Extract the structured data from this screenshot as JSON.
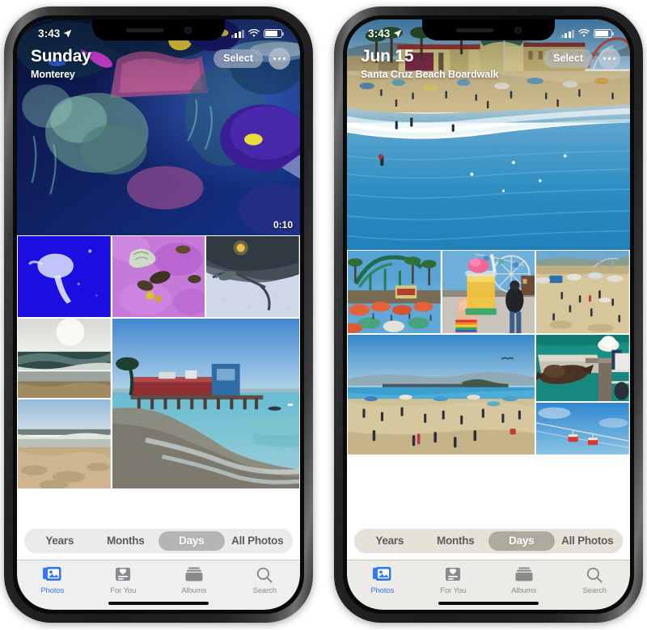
{
  "phones": [
    {
      "id": "phone-left",
      "status_bar": {
        "time": "3:43",
        "location_icon": "location-arrow-icon",
        "signal_icon": "cellular-signal-icon",
        "wifi_icon": "wifi-icon",
        "battery_icon": "battery-icon"
      },
      "header": {
        "title": "Sunday",
        "subtitle": "Monterey",
        "select_label": "Select",
        "more_icon": "ellipsis-icon"
      },
      "hero": {
        "scene": "aquarium-coral-reef",
        "duration": "0:10",
        "is_video": true
      },
      "segmented_control": {
        "items": [
          "Years",
          "Months",
          "Days",
          "All Photos"
        ],
        "selected": "Days",
        "tint": "cool"
      },
      "tab_bar": {
        "tint": "cool",
        "items": [
          {
            "label": "Photos",
            "icon": "photos-icon",
            "active": true
          },
          {
            "label": "For You",
            "icon": "foryou-icon",
            "active": false
          },
          {
            "label": "Albums",
            "icon": "albums-icon",
            "active": false
          },
          {
            "label": "Search",
            "icon": "search-icon",
            "active": false
          }
        ]
      }
    },
    {
      "id": "phone-right",
      "status_bar": {
        "time": "3:43",
        "location_icon": "location-arrow-icon",
        "signal_icon": "cellular-signal-icon",
        "wifi_icon": "wifi-icon",
        "battery_icon": "battery-icon"
      },
      "header": {
        "title": "Jun 15",
        "subtitle": "Santa Cruz Beach Boardwalk",
        "select_label": "Select",
        "more_icon": "ellipsis-icon"
      },
      "hero": {
        "scene": "santa-cruz-beach-aerial",
        "duration": "",
        "is_video": false
      },
      "segmented_control": {
        "items": [
          "Years",
          "Months",
          "Days",
          "All Photos"
        ],
        "selected": "Days",
        "tint": "warm"
      },
      "tab_bar": {
        "tint": "warm",
        "items": [
          {
            "label": "Photos",
            "icon": "photos-icon",
            "active": true
          },
          {
            "label": "For You",
            "icon": "foryou-icon",
            "active": false
          },
          {
            "label": "Albums",
            "icon": "albums-icon",
            "active": false
          },
          {
            "label": "Search",
            "icon": "search-icon",
            "active": false
          }
        ]
      }
    }
  ],
  "accent_color": "#3478f6",
  "thumbnails": {
    "left": [
      "jellyfish-blue-water",
      "purple-flowers-shells",
      "lizard-on-white-sand",
      "ocean-sunlit-shore",
      "monterey-wharf-pier",
      "sandy-beach-dunes"
    ],
    "right": [
      "roller-coaster-umbrellas",
      "frozen-lemonade-hand",
      "crowded-beach-sand",
      "wide-beach-with-pier",
      "sea-lion-on-dock",
      "sky-gondola-ride"
    ]
  }
}
